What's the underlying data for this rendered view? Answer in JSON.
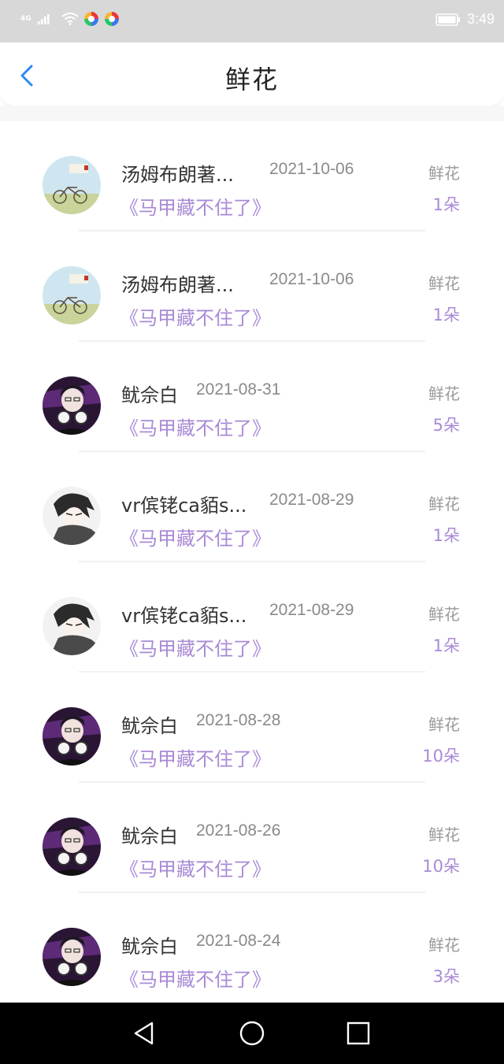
{
  "status_bar": {
    "network": "4G",
    "time": "3:49"
  },
  "header": {
    "title": "鲜花"
  },
  "records": [
    {
      "user": "汤姆布朗著...",
      "date": "2021-10-06",
      "book": "《马甲藏不住了》",
      "gift": "鲜花",
      "count": "1朵",
      "avatar": "bicycle-cover"
    },
    {
      "user": "汤姆布朗著...",
      "date": "2021-10-06",
      "book": "《马甲藏不住了》",
      "gift": "鲜花",
      "count": "1朵",
      "avatar": "bicycle-cover"
    },
    {
      "user": "鱿佘白",
      "date": "2021-08-31",
      "book": "《马甲藏不住了》",
      "gift": "鲜花",
      "count": "5朵",
      "avatar": "boy-headphones"
    },
    {
      "user": "vr傧铑ca貊s...",
      "date": "2021-08-29",
      "book": "《马甲藏不住了》",
      "gift": "鲜花",
      "count": "1朵",
      "avatar": "anime-boy"
    },
    {
      "user": "vr傧铑ca貊s...",
      "date": "2021-08-29",
      "book": "《马甲藏不住了》",
      "gift": "鲜花",
      "count": "1朵",
      "avatar": "anime-boy"
    },
    {
      "user": "鱿佘白",
      "date": "2021-08-28",
      "book": "《马甲藏不住了》",
      "gift": "鲜花",
      "count": "10朵",
      "avatar": "boy-headphones"
    },
    {
      "user": "鱿佘白",
      "date": "2021-08-26",
      "book": "《马甲藏不住了》",
      "gift": "鲜花",
      "count": "10朵",
      "avatar": "boy-headphones"
    },
    {
      "user": "鱿佘白",
      "date": "2021-08-24",
      "book": "《马甲藏不住了》",
      "gift": "鲜花",
      "count": "3朵",
      "avatar": "boy-headphones"
    }
  ],
  "colors": {
    "accent_purple": "#a98ad6",
    "back_blue": "#2a8bf2",
    "status_bar_bg": "#d8d8d8",
    "nav_bar_bg": "#000000"
  },
  "nav_bar": {
    "icons": [
      "back-triangle-icon",
      "home-circle-icon",
      "recents-square-icon"
    ]
  }
}
